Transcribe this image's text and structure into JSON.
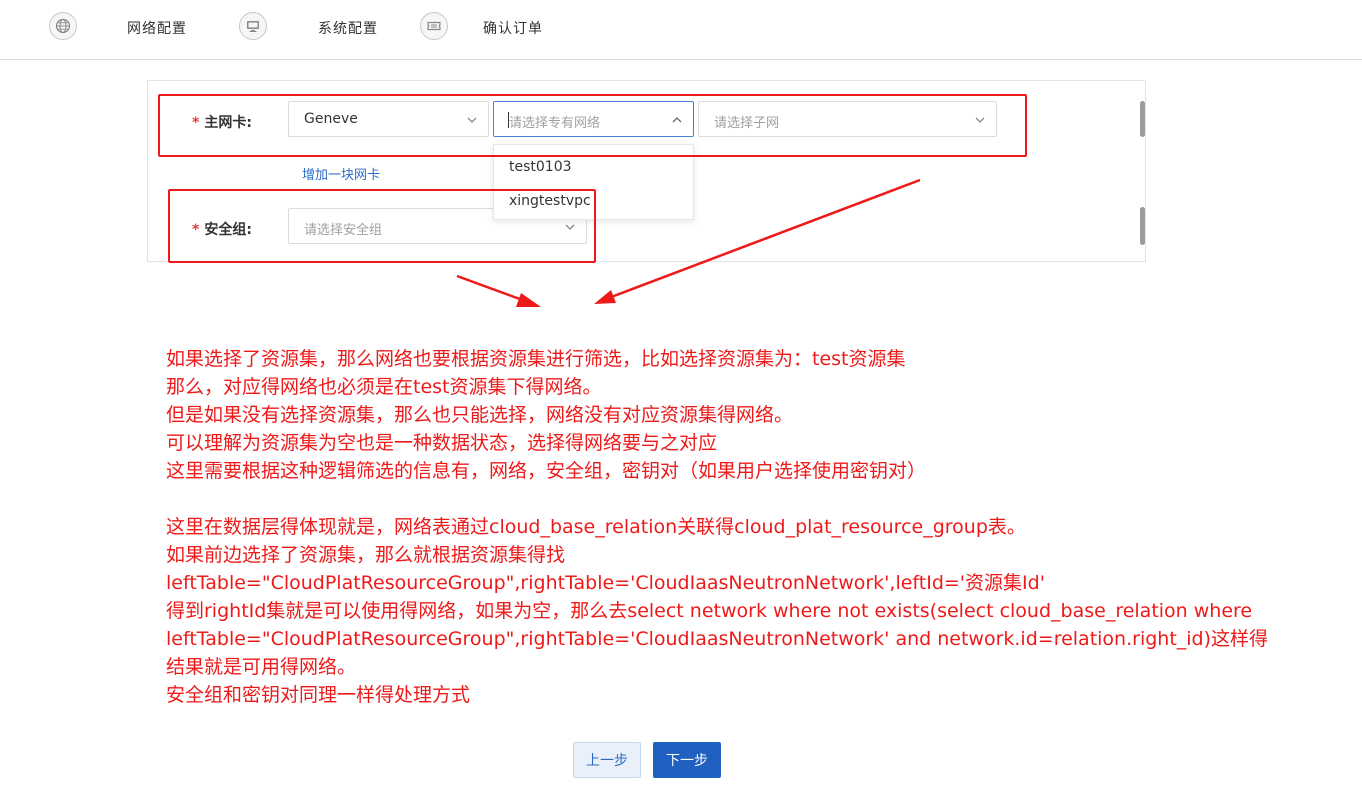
{
  "steps": [
    {
      "label": "网络配置",
      "icon": "globe-icon"
    },
    {
      "label": "系统配置",
      "icon": "monitor-icon"
    },
    {
      "label": "确认订单",
      "icon": "ticket-icon"
    }
  ],
  "form": {
    "nic": {
      "required_mark": "*",
      "label": "主网卡:",
      "type_value": "Geneve",
      "vpc_placeholder": "请选择专有网络",
      "subnet_placeholder": "请选择子网"
    },
    "add_nic_link": "增加一块网卡",
    "security_group": {
      "required_mark": "*",
      "label": "安全组:",
      "placeholder": "请选择安全组"
    }
  },
  "vpc_dropdown": {
    "options": [
      "test0103",
      "xingtestvpc"
    ]
  },
  "annotation": {
    "color": "#ee1a1a",
    "lines": [
      "如果选择了资源集，那么网络也要根据资源集进行筛选，比如选择资源集为：test资源集",
      "那么，对应得网络也必须是在test资源集下得网络。",
      "但是如果没有选择资源集，那么也只能选择，网络没有对应资源集得网络。",
      "可以理解为资源集为空也是一种数据状态，选择得网络要与之对应",
      "这里需要根据这种逻辑筛选的信息有，网络，安全组，密钥对（如果用户选择使用密钥对）",
      "",
      "这里在数据层得体现就是，网络表通过cloud_base_relation关联得cloud_plat_resource_group表。",
      "如果前边选择了资源集，那么就根据资源集得找",
      "leftTable=\"CloudPlatResourceGroup\",rightTable='CloudIaasNeutronNetwork',leftId='资源集Id'",
      "得到rightId集就是可以使用得网络，如果为空，那么去select network where not exists(select cloud_base_relation where",
      "leftTable=\"CloudPlatResourceGroup\",rightTable='CloudIaasNeutronNetwork' and network.id=relation.right_id)这样得",
      "结果就是可用得网络。",
      "安全组和密钥对同理一样得处理方式"
    ]
  },
  "buttons": {
    "prev": "上一步",
    "next": "下一步"
  },
  "colors": {
    "primary": "#2060c0",
    "link": "#2b6bc6",
    "focus_border": "#4a7fd6"
  }
}
